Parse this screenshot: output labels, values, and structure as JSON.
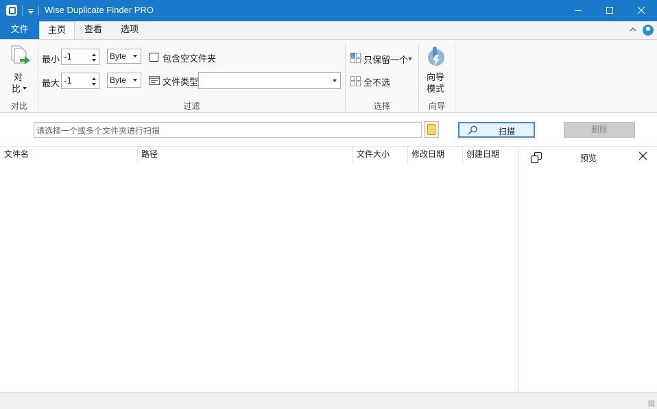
{
  "window": {
    "title": "Wise Duplicate Finder PRO"
  },
  "ribbon_tabs": {
    "file": "文件",
    "home": "主页",
    "view": "查看",
    "options": "选项"
  },
  "compare_group": {
    "button_line1": "对",
    "button_line2": "比",
    "label": "对比"
  },
  "filter_group": {
    "min_label": "最小",
    "min_value": "-1",
    "min_unit": "Byte",
    "max_label": "最大",
    "max_value": "-1",
    "max_unit": "Byte",
    "include_empty_label": "包含空文件夹",
    "include_empty_checked": false,
    "file_type_label": "文件类型",
    "file_type_value": "",
    "label": "过滤"
  },
  "select_group": {
    "keep_one": "只保留一个",
    "select_none": "全不选",
    "label": "选择"
  },
  "wizard_group": {
    "button_line1": "向导",
    "button_line2": "模式",
    "label": "向导"
  },
  "scan_bar": {
    "path_placeholder": "请选择一个或多个文件夹进行扫描",
    "scan_button": "扫描",
    "delete_button": "删除"
  },
  "results_table": {
    "columns": [
      "文件名",
      "路径",
      "文件大小",
      "修改日期",
      "创建日期"
    ],
    "rows": []
  },
  "preview_pane": {
    "title": "预览"
  },
  "colors": {
    "title_bar": "#1979ca",
    "ribbon_bg": "#f8f8f8",
    "scan_border": "#3b8fd7"
  }
}
